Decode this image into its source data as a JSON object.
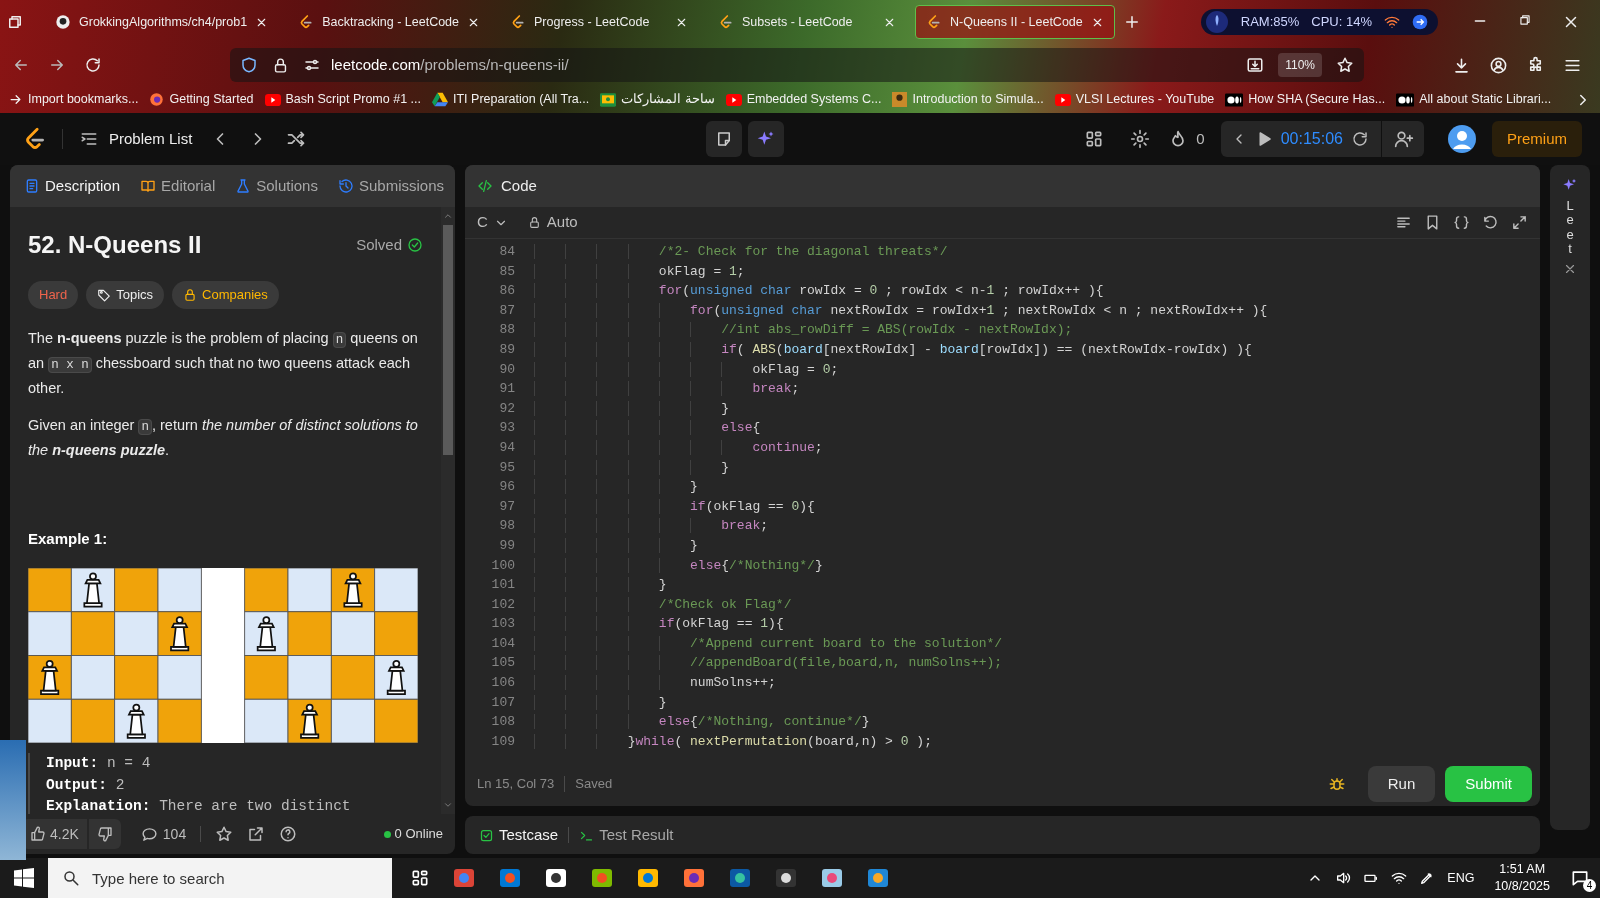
{
  "browser": {
    "tabs": [
      {
        "title": "GrokkingAlgorithms/ch4/prob1",
        "kind": "github",
        "selected": false
      },
      {
        "title": "Backtracking - LeetCode",
        "kind": "leetcode",
        "selected": false
      },
      {
        "title": "Progress - LeetCode",
        "kind": "leetcode",
        "selected": false
      },
      {
        "title": "Subsets - LeetCode",
        "kind": "leetcode",
        "selected": false
      },
      {
        "title": "N-Queens II - LeetCode",
        "kind": "leetcode",
        "selected": true
      }
    ],
    "system_monitor": {
      "ram": "RAM:85%",
      "cpu": "CPU: 14%"
    },
    "address": {
      "host": "leetcode.com",
      "path": "/problems/n-queens-ii/"
    },
    "zoom": "110%",
    "bookmarks": [
      {
        "label": "Import bookmarks...",
        "kind": "import"
      },
      {
        "label": "Getting Started",
        "kind": "firefox"
      },
      {
        "label": "Bash Script Promo #1 ...",
        "kind": "youtube"
      },
      {
        "label": "ITI Preparation (All Tra...",
        "kind": "drive"
      },
      {
        "label": "ساحة المشاركات",
        "kind": "classroom"
      },
      {
        "label": "Embedded Systems C...",
        "kind": "youtube"
      },
      {
        "label": "Introduction to Simula...",
        "kind": "image"
      },
      {
        "label": "VLSI Lectures - YouTube",
        "kind": "youtube"
      },
      {
        "label": "How SHA (Secure Has...",
        "kind": "medium"
      },
      {
        "label": "All about Static Librari...",
        "kind": "medium"
      }
    ]
  },
  "nav": {
    "problem_list": "Problem List",
    "streak": "0",
    "timer": "00:15:06",
    "premium": "Premium"
  },
  "problem": {
    "tabs": [
      {
        "label": "Description",
        "kind": "description",
        "selected": true
      },
      {
        "label": "Editorial",
        "kind": "editorial",
        "selected": false
      },
      {
        "label": "Solutions",
        "kind": "solutions",
        "selected": false
      },
      {
        "label": "Submissions",
        "kind": "submissions",
        "selected": false
      }
    ],
    "title": "52. N-Queens II",
    "status": "Solved",
    "tags": [
      {
        "label": "Hard",
        "kind": "difficulty"
      },
      {
        "label": "Topics",
        "kind": "topics"
      },
      {
        "label": "Companies",
        "kind": "companies"
      }
    ],
    "paragraphs": [
      [
        {
          "kind": "text",
          "text": "The **n-queens** puzzle is the problem of placing "
        },
        {
          "kind": "code",
          "text": "n"
        },
        {
          "kind": "text",
          "text": " queens on an "
        },
        {
          "kind": "code",
          "text": "n x n"
        },
        {
          "kind": "text",
          "text": " chessboard such that no two queens attack each other."
        }
      ],
      [
        {
          "kind": "text",
          "text": "Given an integer "
        },
        {
          "kind": "code",
          "text": "n"
        },
        {
          "kind": "text",
          "text": ", return "
        },
        {
          "kind": "em",
          "text": "the number of distinct solutions to the **n-queens puzzle**"
        },
        {
          "kind": "text",
          "text": "."
        }
      ]
    ],
    "example_title": "Example 1:",
    "example": [
      {
        "label": "Input:",
        "value": "n = 4"
      },
      {
        "label": "Output:",
        "value": "2"
      },
      {
        "label": "Explanation:",
        "value": "There are two distinct"
      }
    ],
    "footer": {
      "likes": "4.2K",
      "comments": "104",
      "online": "0 Online"
    }
  },
  "editor": {
    "title": "Code",
    "language": "C",
    "mode": "Auto",
    "lines": [
      {
        "num": "84",
        "tokens": [
          {
            "kind": "cm",
            "text": "                /*2- Check for the diagonal threats*/"
          }
        ]
      },
      {
        "num": "85",
        "tokens": [
          {
            "kind": "tx",
            "text": "                okFlag = "
          },
          {
            "kind": "num",
            "text": "1"
          },
          {
            "kind": "tx",
            "text": ";"
          }
        ]
      },
      {
        "num": "86",
        "tokens": [
          {
            "kind": "kw",
            "text": "                for"
          },
          {
            "kind": "tx",
            "text": "("
          },
          {
            "kind": "ty",
            "text": "unsigned char"
          },
          {
            "kind": "tx",
            "text": " rowIdx = "
          },
          {
            "kind": "num",
            "text": "0"
          },
          {
            "kind": "tx",
            "text": " ; rowIdx < n-"
          },
          {
            "kind": "num",
            "text": "1"
          },
          {
            "kind": "tx",
            "text": " ; rowIdx++ ){"
          }
        ]
      },
      {
        "num": "87",
        "tokens": [
          {
            "kind": "kw",
            "text": "                    for"
          },
          {
            "kind": "tx",
            "text": "("
          },
          {
            "kind": "ty",
            "text": "unsigned char"
          },
          {
            "kind": "tx",
            "text": " nextRowIdx = rowIdx+"
          },
          {
            "kind": "num",
            "text": "1"
          },
          {
            "kind": "tx",
            "text": " ; nextRowIdx < n ; nextRowIdx++ ){"
          }
        ]
      },
      {
        "num": "88",
        "tokens": [
          {
            "kind": "cm",
            "text": "                        //int abs_rowDiff = ABS(rowIdx - nextRowIdx);"
          }
        ]
      },
      {
        "num": "89",
        "tokens": [
          {
            "kind": "kw",
            "text": "                        if"
          },
          {
            "kind": "tx",
            "text": "( "
          },
          {
            "kind": "fn",
            "text": "ABS"
          },
          {
            "kind": "tx",
            "text": "("
          },
          {
            "kind": "var",
            "text": "board"
          },
          {
            "kind": "tx",
            "text": "[nextRowIdx] - "
          },
          {
            "kind": "var",
            "text": "board"
          },
          {
            "kind": "tx",
            "text": "[rowIdx]) == (nextRowIdx-rowIdx) ){"
          }
        ]
      },
      {
        "num": "90",
        "tokens": [
          {
            "kind": "tx",
            "text": "                            okFlag = "
          },
          {
            "kind": "num",
            "text": "0"
          },
          {
            "kind": "tx",
            "text": ";"
          }
        ]
      },
      {
        "num": "91",
        "tokens": [
          {
            "kind": "kw",
            "text": "                            break"
          },
          {
            "kind": "tx",
            "text": ";"
          }
        ]
      },
      {
        "num": "92",
        "tokens": [
          {
            "kind": "tx",
            "text": "                        }"
          }
        ]
      },
      {
        "num": "93",
        "tokens": [
          {
            "kind": "kw",
            "text": "                        else"
          },
          {
            "kind": "tx",
            "text": "{"
          }
        ]
      },
      {
        "num": "94",
        "tokens": [
          {
            "kind": "kw",
            "text": "                            continue"
          },
          {
            "kind": "tx",
            "text": ";"
          }
        ]
      },
      {
        "num": "95",
        "tokens": [
          {
            "kind": "tx",
            "text": "                        }"
          }
        ]
      },
      {
        "num": "96",
        "tokens": [
          {
            "kind": "tx",
            "text": "                    }"
          }
        ]
      },
      {
        "num": "97",
        "tokens": [
          {
            "kind": "kw",
            "text": "                    if"
          },
          {
            "kind": "tx",
            "text": "(okFlag == "
          },
          {
            "kind": "num",
            "text": "0"
          },
          {
            "kind": "tx",
            "text": "){"
          }
        ]
      },
      {
        "num": "98",
        "tokens": [
          {
            "kind": "kw",
            "text": "                        break"
          },
          {
            "kind": "tx",
            "text": ";"
          }
        ]
      },
      {
        "num": "99",
        "tokens": [
          {
            "kind": "tx",
            "text": "                    }"
          }
        ]
      },
      {
        "num": "100",
        "tokens": [
          {
            "kind": "kw",
            "text": "                    else"
          },
          {
            "kind": "tx",
            "text": "{"
          },
          {
            "kind": "cm",
            "text": "/*Nothing*/"
          },
          {
            "kind": "tx",
            "text": "}"
          }
        ]
      },
      {
        "num": "101",
        "tokens": [
          {
            "kind": "tx",
            "text": "                }"
          }
        ]
      },
      {
        "num": "102",
        "tokens": [
          {
            "kind": "cm",
            "text": "                /*Check ok Flag*/"
          }
        ]
      },
      {
        "num": "103",
        "tokens": [
          {
            "kind": "kw",
            "text": "                if"
          },
          {
            "kind": "tx",
            "text": "(okFlag == "
          },
          {
            "kind": "num",
            "text": "1"
          },
          {
            "kind": "tx",
            "text": "){"
          }
        ]
      },
      {
        "num": "104",
        "tokens": [
          {
            "kind": "cm",
            "text": "                    /*Append current board to the solution*/"
          }
        ]
      },
      {
        "num": "105",
        "tokens": [
          {
            "kind": "cm",
            "text": "                    //appendBoard(file,board,n, numSolns++);"
          }
        ]
      },
      {
        "num": "106",
        "tokens": [
          {
            "kind": "tx",
            "text": "                    numSolns++;"
          }
        ]
      },
      {
        "num": "107",
        "tokens": [
          {
            "kind": "tx",
            "text": "                }"
          }
        ]
      },
      {
        "num": "108",
        "tokens": [
          {
            "kind": "kw",
            "text": "                else"
          },
          {
            "kind": "tx",
            "text": "{"
          },
          {
            "kind": "cm",
            "text": "/*Nothing, continue*/"
          },
          {
            "kind": "tx",
            "text": "}"
          }
        ]
      },
      {
        "num": "109",
        "tokens": [
          {
            "kind": "tx",
            "text": "            }"
          },
          {
            "kind": "kw",
            "text": "while"
          },
          {
            "kind": "tx",
            "text": "( "
          },
          {
            "kind": "fn",
            "text": "nextPermutation"
          },
          {
            "kind": "tx",
            "text": "(board,n) > "
          },
          {
            "kind": "num",
            "text": "0"
          },
          {
            "kind": "tx",
            "text": " );"
          }
        ]
      }
    ],
    "status": {
      "position": "Ln 15, Col 73",
      "saved": "Saved"
    },
    "run": "Run",
    "submit": "Submit",
    "bottom_tabs": [
      {
        "label": "Testcase",
        "kind": "testcase",
        "selected": true
      },
      {
        "label": "Test Result",
        "kind": "result",
        "selected": false
      }
    ]
  },
  "side_panel": {
    "label": "Leet"
  },
  "taskbar": {
    "search_placeholder": "Type here to search",
    "language": "ENG",
    "time": "1:51 AM",
    "date": "10/8/2025",
    "notifications": "4"
  }
}
